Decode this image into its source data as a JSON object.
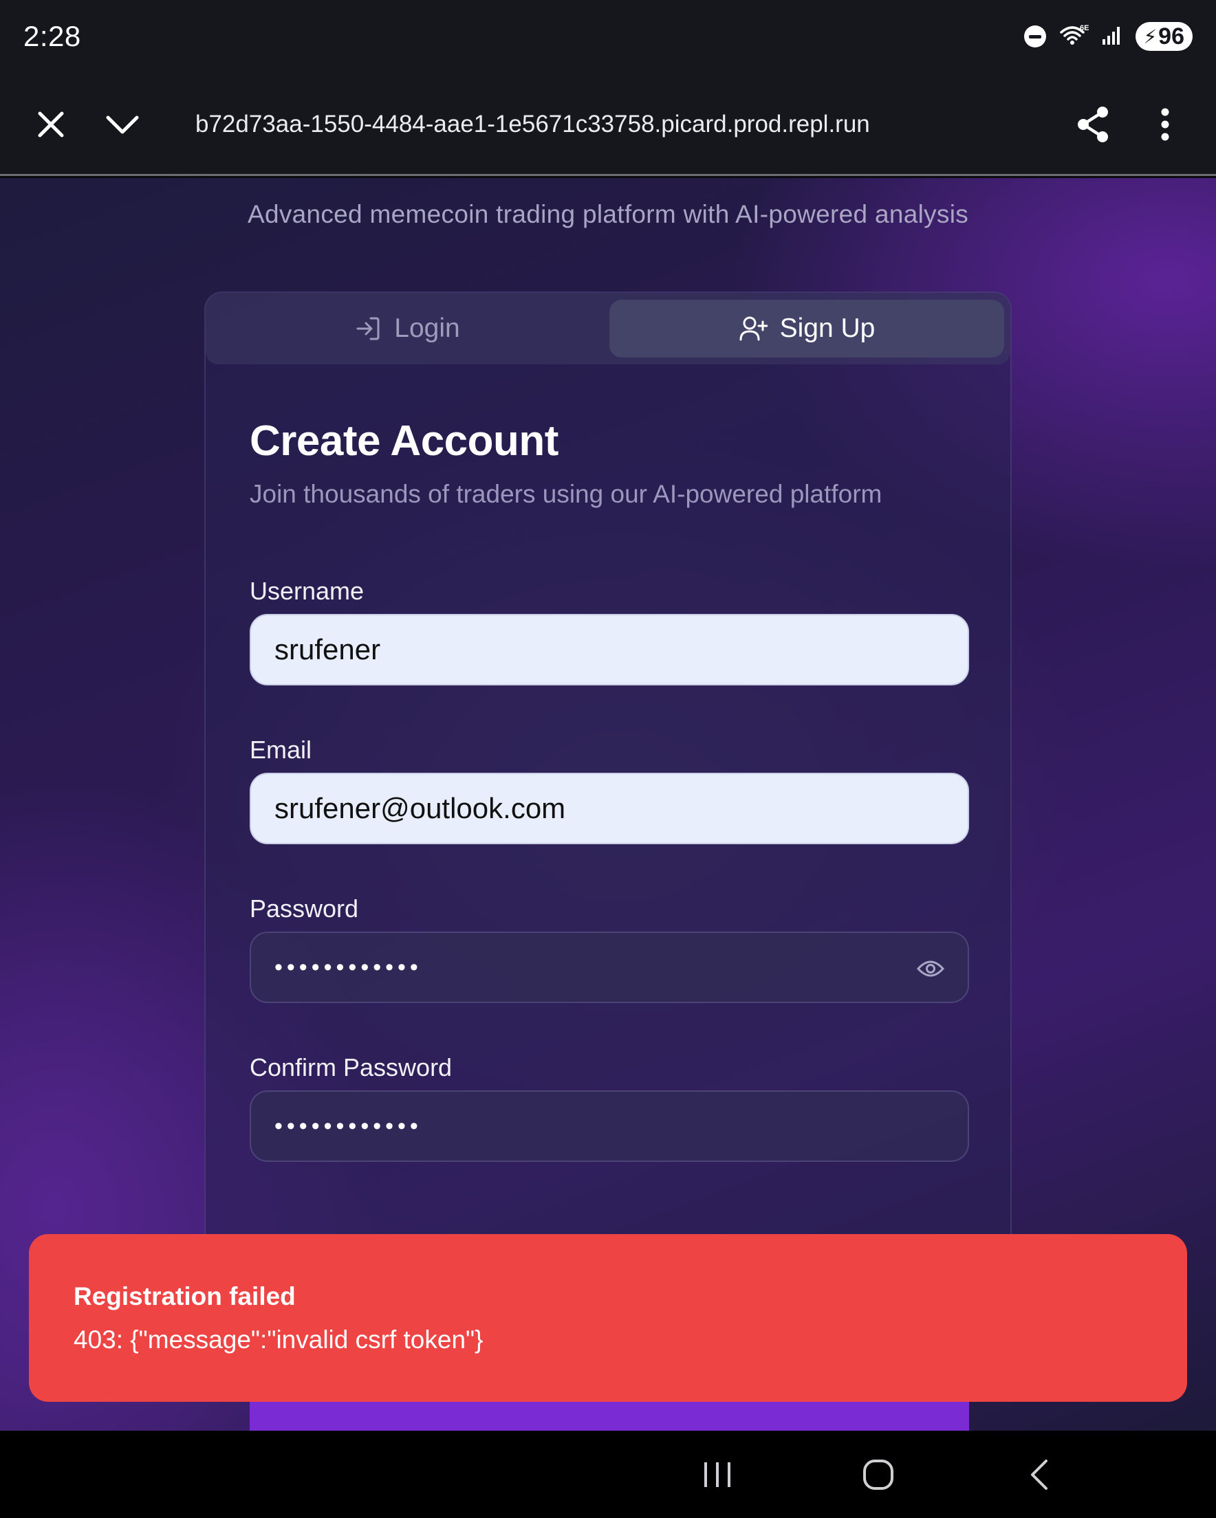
{
  "status_bar": {
    "time": "2:28",
    "battery": "96",
    "icons": [
      "do-not-disturb-icon",
      "wifi-6e-icon",
      "signal-icon",
      "battery-charging-icon"
    ]
  },
  "browser": {
    "url": "b72d73aa-1550-4484-aae1-1e5671c33758.picard.prod.repl.run",
    "icons": [
      "close-icon",
      "chevron-down-icon",
      "share-icon",
      "more-vert-icon"
    ]
  },
  "page": {
    "tagline": "Advanced memecoin trading platform with AI-powered analysis",
    "tabs": [
      {
        "label": "Login",
        "icon": "login-icon",
        "active": false
      },
      {
        "label": "Sign Up",
        "icon": "user-plus-icon",
        "active": true
      }
    ],
    "form": {
      "title": "Create Account",
      "subtitle": "Join thousands of traders using our AI-powered platform",
      "username": {
        "label": "Username",
        "value": "srufener"
      },
      "email": {
        "label": "Email",
        "value": "srufener@outlook.com"
      },
      "password": {
        "label": "Password",
        "value": "••••••••••••"
      },
      "confirm_password": {
        "label": "Confirm Password",
        "value": "••••••••••••"
      }
    }
  },
  "toast": {
    "title": "Registration failed",
    "message": "403: {\"message\":\"invalid csrf token\"}",
    "color": "#ef4444"
  },
  "colors": {
    "accent": "#7a2bd4",
    "error": "#ef4444"
  }
}
